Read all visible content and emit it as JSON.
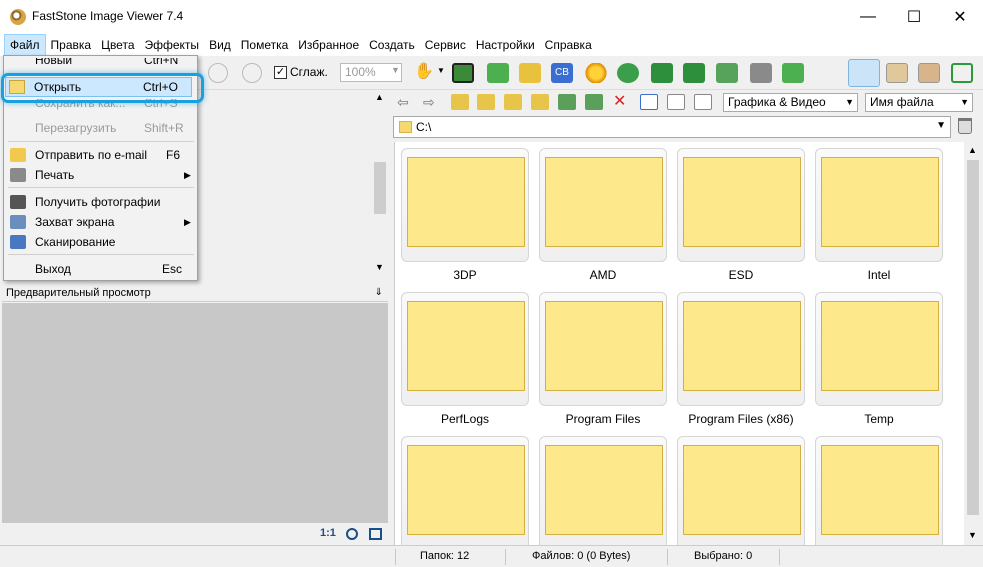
{
  "window": {
    "title": "FastStone Image Viewer 7.4"
  },
  "menubar": [
    "Файл",
    "Правка",
    "Цвета",
    "Эффекты",
    "Вид",
    "Пометка",
    "Избранное",
    "Создать",
    "Сервис",
    "Настройки",
    "Справка"
  ],
  "toolbar": {
    "smooth_label": "Сглаж.",
    "zoom_value": "100%"
  },
  "file_menu": {
    "items": [
      {
        "label": "Новый",
        "shortcut": "Ctrl+N",
        "state": "partial"
      },
      {
        "label": "Открыть",
        "shortcut": "Ctrl+O",
        "state": "highlighted"
      },
      {
        "label": "Сохранить как...",
        "shortcut": "Ctrl+S",
        "state": "disabled"
      },
      {
        "label": "Перезагрузить",
        "shortcut": "Shift+R",
        "state": "disabled"
      },
      {
        "label": "Отправить по e-mail",
        "shortcut": "F6",
        "state": "normal"
      },
      {
        "label": "Печать",
        "shortcut": "",
        "state": "submenu"
      },
      {
        "label": "Получить фотографии",
        "shortcut": "",
        "state": "normal"
      },
      {
        "label": "Захват экрана",
        "shortcut": "",
        "state": "submenu"
      },
      {
        "label": "Сканирование",
        "shortcut": "",
        "state": "normal"
      },
      {
        "label": "Выход",
        "shortcut": "Esc",
        "state": "normal"
      }
    ]
  },
  "preview": {
    "header": "Предварительный просмотр",
    "zoom_label": "1:1"
  },
  "browser": {
    "filter_value": "Графика & Видео",
    "sort_value": "Имя файла",
    "path": "C:\\",
    "folders": [
      "3DP",
      "AMD",
      "ESD",
      "Intel",
      "PerfLogs",
      "Program Files",
      "Program Files (x86)",
      "Temp",
      "",
      "",
      "",
      ""
    ]
  },
  "status": {
    "folders": "Папок: 12",
    "files": "Файлов: 0 (0 Bytes)",
    "selected": "Выбрано: 0"
  },
  "colors": {
    "highlight_ring": "#1aa0e0",
    "folder_fill": "#fde98b"
  }
}
